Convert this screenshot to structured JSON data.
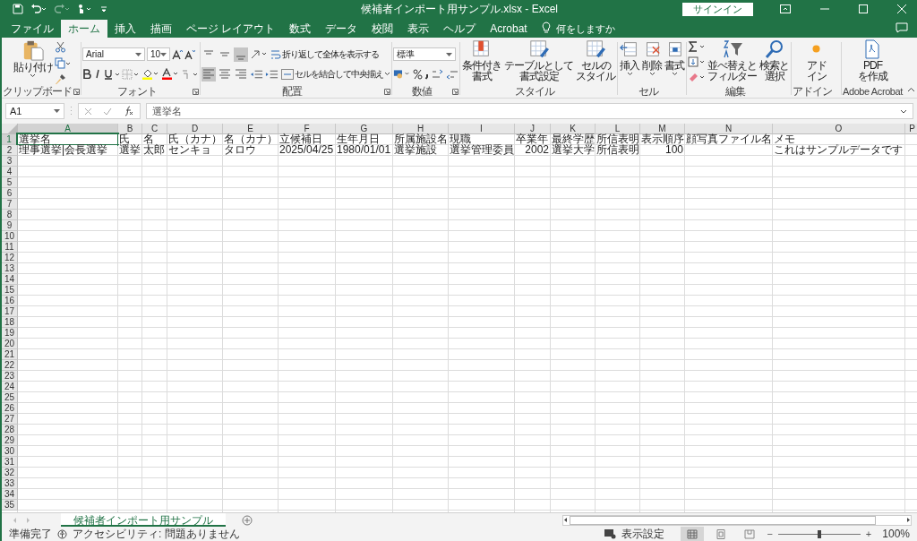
{
  "window": {
    "title": "候補者インポート用サンプル.xlsx  -  Excel",
    "signin": "サインイン"
  },
  "tabs": [
    {
      "label": "ファイル",
      "selected": false
    },
    {
      "label": "ホーム",
      "selected": true
    },
    {
      "label": "挿入",
      "selected": false
    },
    {
      "label": "描画",
      "selected": false
    },
    {
      "label": "ページ レイアウト",
      "selected": false
    },
    {
      "label": "数式",
      "selected": false
    },
    {
      "label": "データ",
      "selected": false
    },
    {
      "label": "校閲",
      "selected": false
    },
    {
      "label": "表示",
      "selected": false
    },
    {
      "label": "ヘルプ",
      "selected": false
    },
    {
      "label": "Acrobat",
      "selected": false
    }
  ],
  "tell_me": {
    "placeholder": "何をしますか"
  },
  "ribbon": {
    "clipboard": {
      "label": "クリップボード",
      "paste": "貼り付け"
    },
    "font": {
      "label": "フォント",
      "font_name": "Arial",
      "font_size": "10"
    },
    "alignment": {
      "label": "配置",
      "wrap_text": "折り返して全体を表示する",
      "merge_center": "セルを結合して中央揃え",
      "vertical": [
        {
          "selected": false
        },
        {
          "selected": false
        },
        {
          "selected": true
        }
      ],
      "horizontal": [
        {
          "selected": true
        },
        {
          "selected": false
        },
        {
          "selected": false
        }
      ]
    },
    "number": {
      "label": "数値",
      "format": "標準"
    },
    "styles": {
      "label": "スタイル",
      "buttons": [
        [
          "条件付き",
          "書式"
        ],
        [
          "テーブルとして",
          "書式設定"
        ],
        [
          "セルの",
          "スタイル"
        ]
      ]
    },
    "cells": {
      "label": "セル",
      "buttons": [
        [
          "挿入"
        ],
        [
          "削除"
        ],
        [
          "書式"
        ]
      ]
    },
    "editing": {
      "label": "編集",
      "buttons": [
        [
          "並べ替えと",
          "フィルター"
        ],
        [
          "検索と",
          "選択"
        ]
      ]
    },
    "addins": {
      "label": "アドイン",
      "buttons": [
        [
          "アド",
          "イン"
        ]
      ]
    },
    "acrobat": {
      "label": "Adobe Acrobat",
      "buttons": [
        [
          "PDF",
          "を作成"
        ]
      ]
    }
  },
  "formula_bar": {
    "name_box": "A1",
    "formula": "選挙名"
  },
  "columns": [
    {
      "letter": "A",
      "selected": true
    },
    {
      "letter": "B",
      "selected": false
    },
    {
      "letter": "C",
      "selected": false
    },
    {
      "letter": "D",
      "selected": false
    },
    {
      "letter": "E",
      "selected": false
    },
    {
      "letter": "F",
      "selected": false
    },
    {
      "letter": "G",
      "selected": false
    },
    {
      "letter": "H",
      "selected": false
    },
    {
      "letter": "I",
      "selected": false
    },
    {
      "letter": "J",
      "selected": false
    },
    {
      "letter": "K",
      "selected": false
    },
    {
      "letter": "L",
      "selected": false
    },
    {
      "letter": "M",
      "selected": false
    },
    {
      "letter": "N",
      "selected": false
    },
    {
      "letter": "O",
      "selected": false
    },
    {
      "letter": "P",
      "selected": false
    }
  ],
  "rows": [
    {
      "number": "1",
      "selected": true,
      "cells": [
        {
          "text": "選挙名",
          "kind": "text",
          "selected": true
        },
        {
          "text": "氏",
          "kind": "text",
          "selected": false
        },
        {
          "text": "名",
          "kind": "text",
          "selected": false
        },
        {
          "text": "氏（カナ）",
          "kind": "text",
          "selected": false
        },
        {
          "text": "名（カナ）",
          "kind": "text",
          "selected": false
        },
        {
          "text": "立候補日",
          "kind": "text",
          "selected": false
        },
        {
          "text": "生年月日",
          "kind": "text",
          "selected": false
        },
        {
          "text": "所属施設名",
          "kind": "text",
          "selected": false
        },
        {
          "text": "現職",
          "kind": "text",
          "selected": false
        },
        {
          "text": "卒業年",
          "kind": "text",
          "selected": false
        },
        {
          "text": "最終学歴",
          "kind": "text",
          "selected": false
        },
        {
          "text": "所信表明",
          "kind": "text",
          "selected": false
        },
        {
          "text": "表示順序",
          "kind": "text",
          "selected": false
        },
        {
          "text": "顔写真ファイル名",
          "kind": "text",
          "selected": false
        },
        {
          "text": "メモ",
          "kind": "text",
          "selected": false
        }
      ]
    },
    {
      "number": "2",
      "selected": false,
      "cells": [
        {
          "text": "理事選挙|会長選挙",
          "kind": "text",
          "selected": false
        },
        {
          "text": "選挙",
          "kind": "text",
          "selected": false
        },
        {
          "text": "太郎",
          "kind": "text",
          "selected": false
        },
        {
          "text": "センキョ",
          "kind": "text",
          "selected": false
        },
        {
          "text": "タロウ",
          "kind": "text",
          "selected": false
        },
        {
          "text": "2025/04/25",
          "kind": "text",
          "selected": false
        },
        {
          "text": "1980/01/01",
          "kind": "text",
          "selected": false
        },
        {
          "text": "選挙施設",
          "kind": "text",
          "selected": false
        },
        {
          "text": "選挙管理委員",
          "kind": "text",
          "selected": false
        },
        {
          "text": "2002",
          "kind": "number",
          "selected": false
        },
        {
          "text": "選挙大学",
          "kind": "text",
          "selected": false
        },
        {
          "text": "所信表明",
          "kind": "text",
          "selected": false
        },
        {
          "text": "100",
          "kind": "number",
          "selected": false
        },
        null,
        {
          "text": "これはサンプルデータです",
          "kind": "text",
          "selected": false
        }
      ]
    },
    {
      "number": "3",
      "selected": false
    },
    {
      "number": "4",
      "selected": false
    },
    {
      "number": "5",
      "selected": false
    },
    {
      "number": "6",
      "selected": false
    },
    {
      "number": "7",
      "selected": false
    },
    {
      "number": "8",
      "selected": false
    },
    {
      "number": "9",
      "selected": false
    },
    {
      "number": "10",
      "selected": false
    },
    {
      "number": "11",
      "selected": false
    },
    {
      "number": "12",
      "selected": false
    },
    {
      "number": "13",
      "selected": false
    },
    {
      "number": "14",
      "selected": false
    },
    {
      "number": "15",
      "selected": false
    },
    {
      "number": "16",
      "selected": false
    },
    {
      "number": "17",
      "selected": false
    },
    {
      "number": "18",
      "selected": false
    },
    {
      "number": "19",
      "selected": false
    },
    {
      "number": "20",
      "selected": false
    },
    {
      "number": "21",
      "selected": false
    },
    {
      "number": "22",
      "selected": false
    },
    {
      "number": "23",
      "selected": false
    },
    {
      "number": "24",
      "selected": false
    },
    {
      "number": "25",
      "selected": false
    },
    {
      "number": "26",
      "selected": false
    },
    {
      "number": "27",
      "selected": false
    },
    {
      "number": "28",
      "selected": false
    },
    {
      "number": "29",
      "selected": false
    },
    {
      "number": "30",
      "selected": false
    },
    {
      "number": "31",
      "selected": false
    },
    {
      "number": "32",
      "selected": false
    },
    {
      "number": "33",
      "selected": false
    },
    {
      "number": "34",
      "selected": false
    },
    {
      "number": "35",
      "selected": false
    }
  ],
  "sheet_tabs": [
    {
      "label": "候補者インポート用サンプル",
      "selected": true
    }
  ],
  "status_bar": {
    "ready": "準備完了",
    "accessibility": "アクセシビリティ: 問題ありません",
    "display_settings": "表示設定",
    "view_buttons": [
      {
        "selected": true
      },
      {
        "selected": false
      },
      {
        "selected": false
      }
    ],
    "zoom_out": "−",
    "zoom": {
      "level": 0.5,
      "reading": "100%"
    },
    "zoom_in": "+"
  }
}
